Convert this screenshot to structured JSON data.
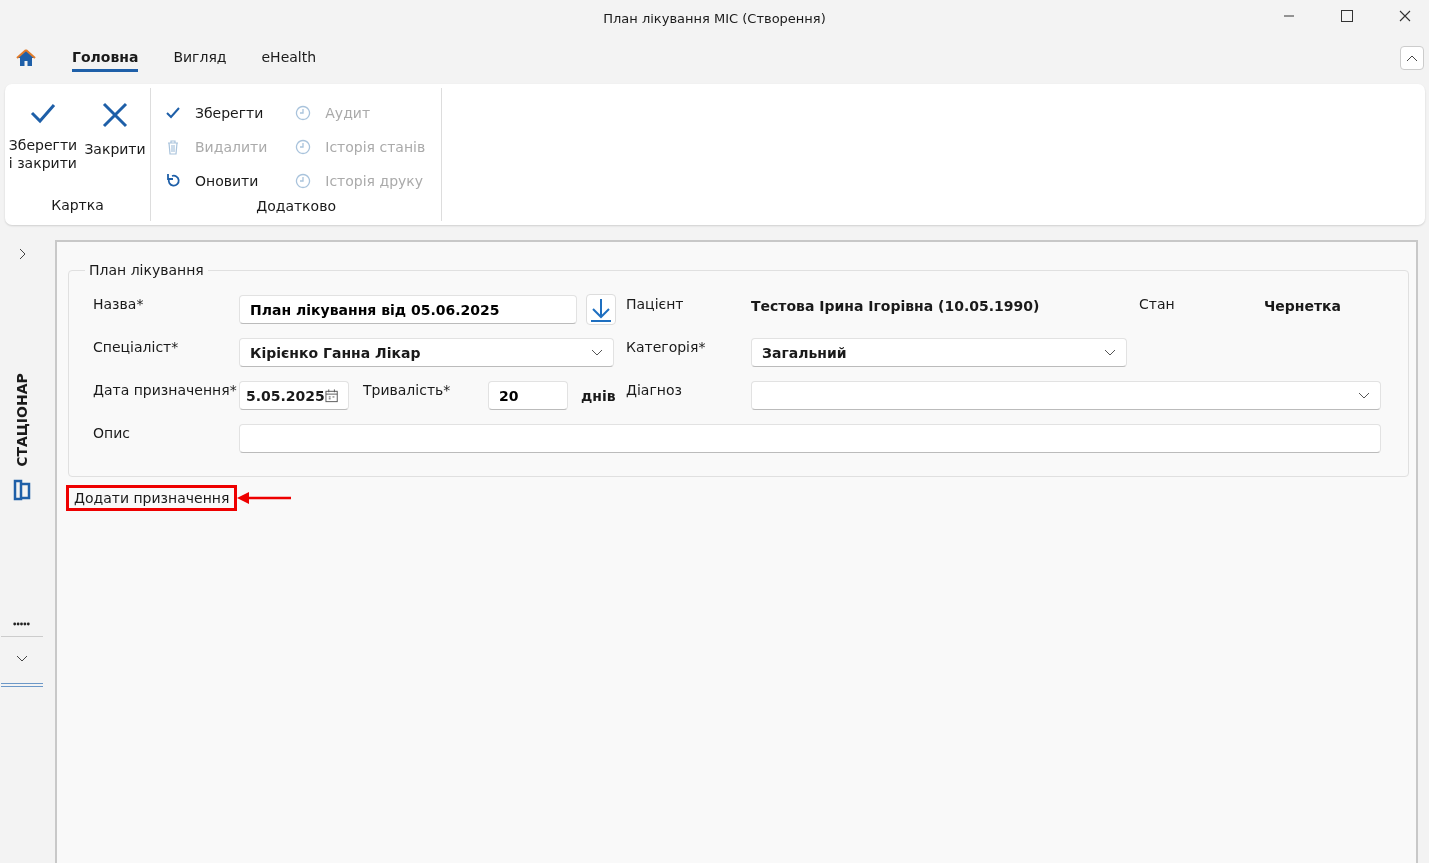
{
  "window": {
    "title": "План лікування МІС (Створення)"
  },
  "tabs": [
    {
      "label": "Головна",
      "selected": true
    },
    {
      "label": "Вигляд",
      "selected": false
    },
    {
      "label": "eHealth",
      "selected": false
    }
  ],
  "ribbon": {
    "groups": [
      {
        "label": "Картка",
        "items": [
          {
            "kind": "large",
            "label": "Зберегти і закрити",
            "disabled": false
          },
          {
            "kind": "large",
            "label": "Закрити",
            "disabled": false
          }
        ]
      },
      {
        "label": "Додатково",
        "items": [
          {
            "kind": "small",
            "label": "Зберегти",
            "disabled": false
          },
          {
            "kind": "small",
            "label": "Видалити",
            "disabled": true
          },
          {
            "kind": "small",
            "label": "Оновити",
            "disabled": false
          },
          {
            "kind": "small",
            "label": "Аудит",
            "disabled": true
          },
          {
            "kind": "small",
            "label": "Історія станів",
            "disabled": true
          },
          {
            "kind": "small",
            "label": "Історія друку",
            "disabled": true
          }
        ]
      }
    ]
  },
  "sidebar": {
    "label": "СТАЦІОНАР"
  },
  "form": {
    "legend": "План лікування",
    "fields": [
      {
        "kind": "text-download",
        "label": "Назва*",
        "value": "План лікування від 05.06.2025"
      },
      {
        "kind": "static",
        "label": "Пацієнт",
        "value": "Тестова Ірина Ігорівна (10.05.1990)"
      },
      {
        "kind": "static",
        "label": "Стан",
        "value": "Чернетка"
      },
      {
        "kind": "combo",
        "label": "Спеціаліст*",
        "value": "Кірієнко Ганна Лікар"
      },
      {
        "kind": "combo",
        "label": "Категорія*",
        "value": "Загальний"
      },
      {
        "kind": "date",
        "label": "Дата призначення*",
        "value": "5.05.2025"
      },
      {
        "kind": "number",
        "label": "Тривалість*",
        "value": "20",
        "unit": "днів"
      },
      {
        "kind": "combo",
        "label": "Діагноз"
      },
      {
        "kind": "text",
        "label": "Опис"
      }
    ]
  },
  "add_button": {
    "label": "Додати призначення",
    "highlighted": true
  }
}
